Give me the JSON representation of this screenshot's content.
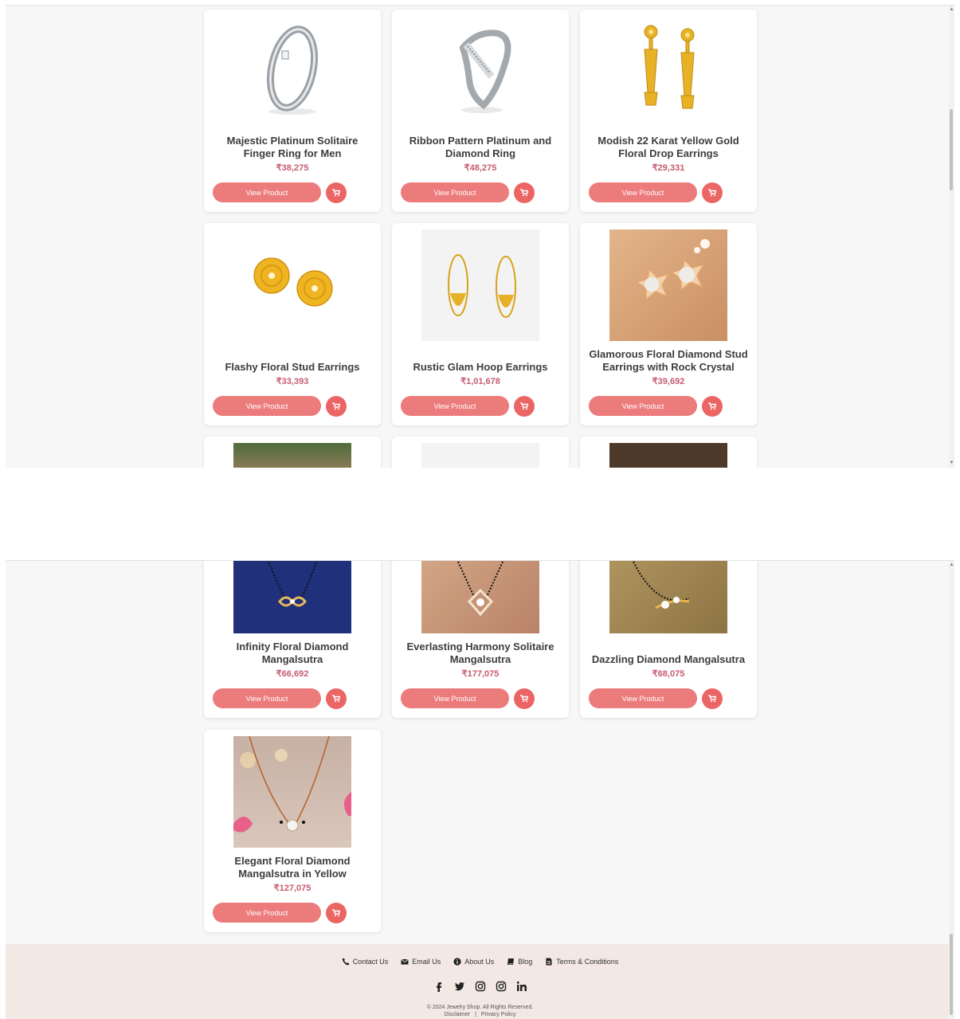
{
  "products": [
    {
      "title": "Majestic Platinum Solitaire Finger Ring for Men",
      "price": "₹38,275",
      "image": "platinum-ring-icon"
    },
    {
      "title": "Ribbon Pattern Platinum and Diamond Ring",
      "price": "₹48,275",
      "image": "diamond-ring-icon"
    },
    {
      "title": "Modish 22 Karat Yellow Gold Floral Drop Earrings",
      "price": "₹29,331",
      "image": "gold-drop-earrings-icon"
    },
    {
      "title": "Flashy Floral Stud Earrings",
      "price": "₹33,393",
      "image": "floral-stud-earrings-icon"
    },
    {
      "title": "Rustic Glam Hoop Earrings",
      "price": "₹1,01,678",
      "image": "hoop-earrings-icon"
    },
    {
      "title": "Glamorous Floral Diamond Stud Earrings with Rock Crystal",
      "price": "₹39,692",
      "image": "pearl-stud-earrings-photo"
    },
    {
      "title": "Infinity Floral Diamond Mangalsutra",
      "price": "₹66,692",
      "image": "mangalsutra-blue-photo"
    },
    {
      "title": "Everlasting Harmony Solitaire Mangalsutra",
      "price": "₹177,075",
      "image": "mangalsutra-beige-photo"
    },
    {
      "title": "Dazzling Diamond Mangalsutra",
      "price": "₹68,075",
      "image": "mangalsutra-olive-photo"
    },
    {
      "title": "Elegant Floral Diamond Mangalsutra in Yellow",
      "price": "₹127,075",
      "image": "mangalsutra-pink-photo"
    }
  ],
  "buttons": {
    "view_product": "View Product"
  },
  "footer": {
    "links": [
      {
        "label": "Contact Us",
        "icon": "phone-icon"
      },
      {
        "label": "Email Us",
        "icon": "envelope-icon"
      },
      {
        "label": "About Us",
        "icon": "info-icon"
      },
      {
        "label": "Blog",
        "icon": "book-icon"
      },
      {
        "label": "Terms & Conditions",
        "icon": "document-icon"
      }
    ],
    "socials": [
      "facebook-icon",
      "twitter-icon",
      "instagram-icon",
      "instagram-icon",
      "linkedin-icon"
    ],
    "copyright": "© 2024 Jewelry Shop. All Rights Reserved.",
    "legal_links": [
      "Disclaimer",
      "Privacy Policy"
    ],
    "legal_separator": "|"
  },
  "colors": {
    "accent": "#ec7b7b",
    "cart": "#ec6565",
    "price": "#c65b70",
    "footer_bg": "#f3e8e4"
  }
}
